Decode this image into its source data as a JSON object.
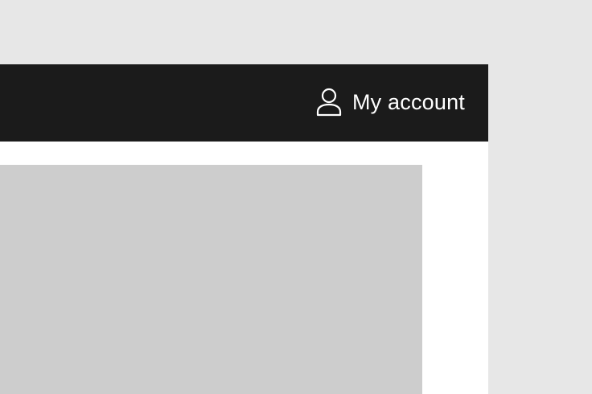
{
  "header": {
    "account": {
      "label": "My account",
      "icon": "user-icon"
    }
  },
  "colors": {
    "background": "#e7e7e7",
    "header": "#1b1b1b",
    "surface": "#ffffff",
    "placeholder": "#cdcdcd",
    "header_text": "#ffffff"
  }
}
